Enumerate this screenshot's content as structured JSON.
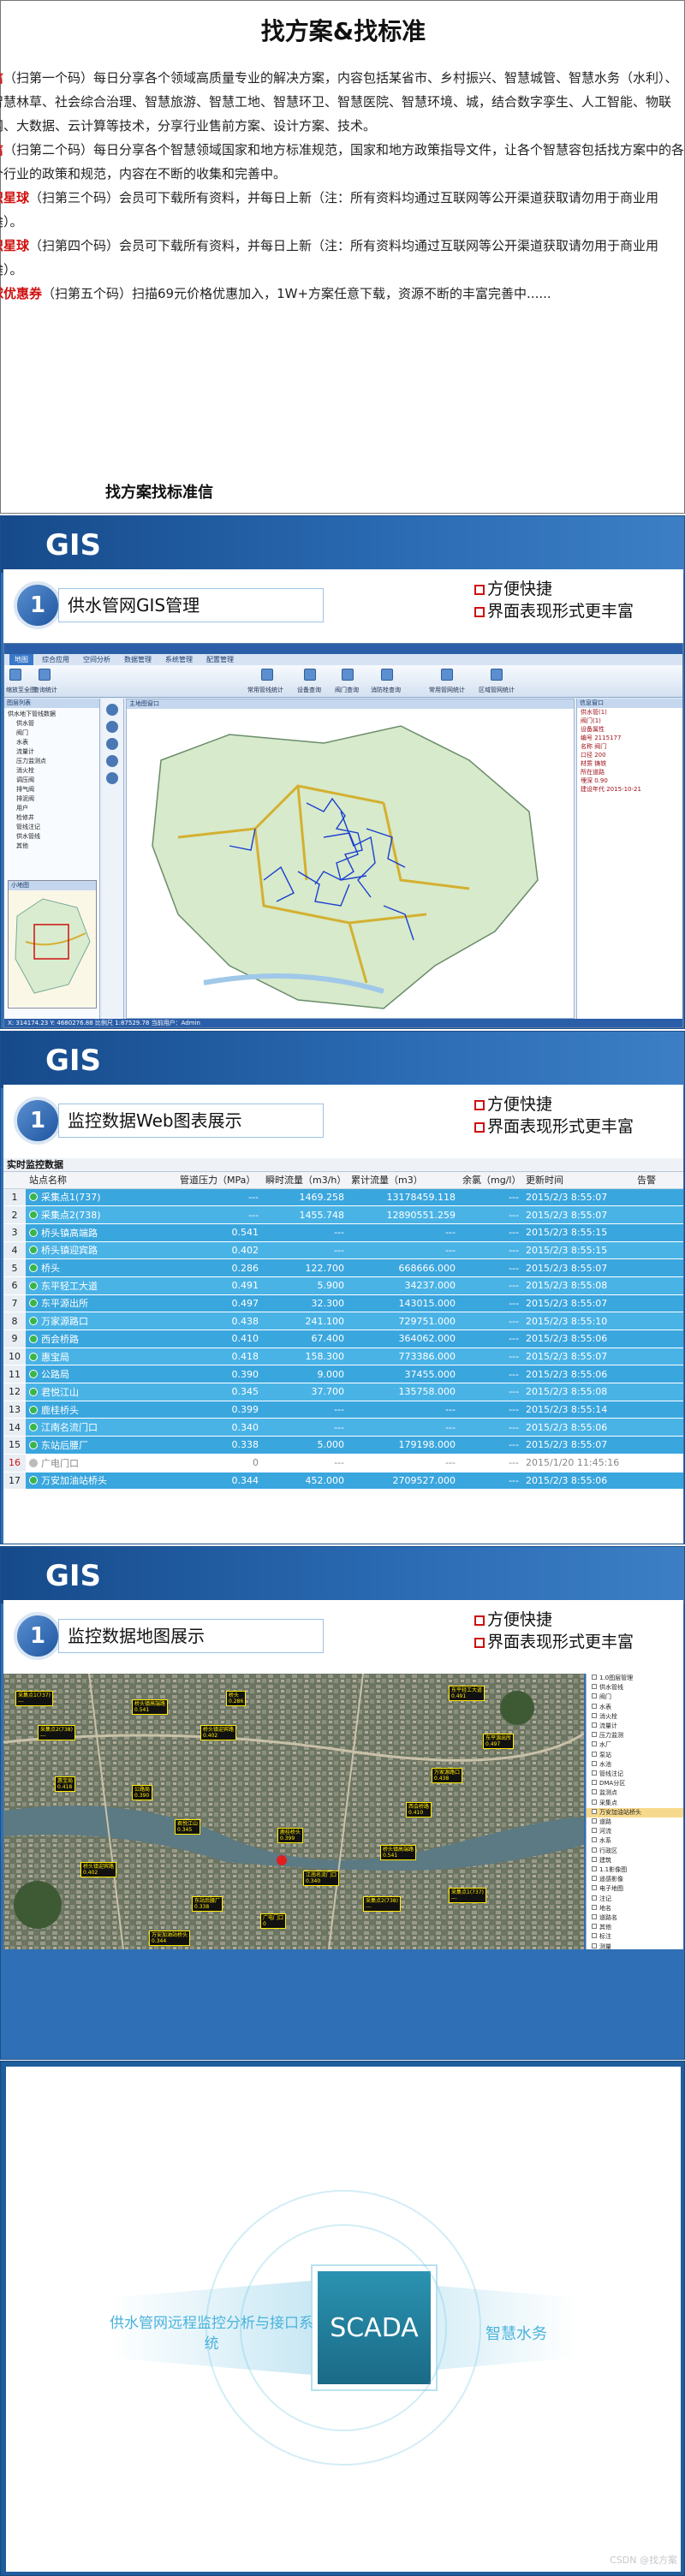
{
  "intro": {
    "title": "找方案&找标准",
    "paragraphs": [
      {
        "tag": "信",
        "text": "（扫第一个码）每日分享各个领域高质量专业的解决方案，内容包括某省市、乡村振兴、智慧城管、智慧水务（水利）、智慧林草、社会综合治理、智慧旅游、智慧工地、智慧环卫、智慧医院、智慧环境、城，结合数字孪生、人工智能、物联网、大数据、云计算等技术，分享行业售前方案、设计方案、技术。"
      },
      {
        "tag": "信",
        "text": "（扫第二个码）每日分享各个智慧领域国家和地方标准规范，国家和地方政策指导文件，让各个智慧容包括找方案中的各个行业的政策和规范，内容在不断的收集和完善中。"
      },
      {
        "tag": "识星球",
        "text": "（扫第三个码）会员可下载所有资料，并每日上新（注：所有资料均通过互联网等公开渠道获取请勿用于商业用途）。"
      },
      {
        "tag": "识星球",
        "text": "（扫第四个码）会员可下载所有资料，并每日上新（注：所有资料均通过互联网等公开渠道获取请勿用于商业用途）。"
      },
      {
        "tag": "球优惠券",
        "text": "（扫第五个码）扫描69元价格优惠加入，1W+方案任意下载，资源不断的丰富完善中......"
      }
    ],
    "footer_label": "找方案找标准信"
  },
  "slide1": {
    "section": "GIS",
    "number": "1",
    "title": "供水管网GIS管理",
    "bullets": [
      "方便快捷",
      "界面表现形式更丰富"
    ],
    "app": {
      "tabs": [
        "地图",
        "综合应用",
        "空间分析",
        "数据管理",
        "系统管理",
        "配置管理"
      ],
      "ribbon_labels": [
        "缩放至全图",
        "查询统计",
        "常用管线统计",
        "设备查询",
        "阀门查询",
        "消防栓查询",
        "常用管网统计",
        "区域管网统计"
      ],
      "left_header": "图层列表",
      "tree": [
        "供水地下管线数据",
        "供水管",
        "阀门",
        "水表",
        "流量计",
        "压力监测点",
        "消火栓",
        "调压阀",
        "排气阀",
        "排泥阀",
        "用户",
        "检修井",
        "管线注记",
        "供水管线",
        "其他"
      ],
      "mini_header": "小地图",
      "map_tab": "主地图窗口",
      "right_header": "信息窗口",
      "right_rows": [
        "供水管(1)",
        "阀门(1)",
        "设备属性",
        "编号 2115177",
        "名称 阀门",
        "口径 200",
        "材质 铸铁",
        "所在道路",
        "埋深 0.90",
        "建设年代 2015-10-21"
      ],
      "status": "X: 314174.23  Y: 4680276.88  比例尺 1:87529.78  当前用户：Admin"
    }
  },
  "slide2": {
    "section": "GIS",
    "number": "1",
    "title": "监控数据Web图表展示",
    "bullets": [
      "方便快捷",
      "界面表现形式更丰富"
    ],
    "caption": "实时监控数据",
    "columns": [
      "站点名称",
      "管道压力（MPa）",
      "瞬时流量（m3/h）",
      "累计流量（m3）",
      "余氯（mg/l）",
      "更新时间",
      "告警"
    ],
    "rows": [
      {
        "no": "1",
        "name": "采集点1(737)",
        "p": "---",
        "q": "1469.258",
        "sum": "13178459.118",
        "cl": "---",
        "time": "2015/2/3 8:55:07",
        "ok": true
      },
      {
        "no": "2",
        "name": "采集点2(738)",
        "p": "---",
        "q": "1455.748",
        "sum": "12890551.259",
        "cl": "---",
        "time": "2015/2/3 8:55:07",
        "ok": true
      },
      {
        "no": "3",
        "name": "桥头镇高端路",
        "p": "0.541",
        "q": "---",
        "sum": "---",
        "cl": "---",
        "time": "2015/2/3 8:55:15",
        "ok": true
      },
      {
        "no": "4",
        "name": "桥头镇迎宾路",
        "p": "0.402",
        "q": "---",
        "sum": "---",
        "cl": "---",
        "time": "2015/2/3 8:55:15",
        "ok": true
      },
      {
        "no": "5",
        "name": "桥头",
        "p": "0.286",
        "q": "122.700",
        "sum": "668666.000",
        "cl": "---",
        "time": "2015/2/3 8:55:07",
        "ok": true
      },
      {
        "no": "6",
        "name": "东平轻工大道",
        "p": "0.491",
        "q": "5.900",
        "sum": "34237.000",
        "cl": "---",
        "time": "2015/2/3 8:55:08",
        "ok": true
      },
      {
        "no": "7",
        "name": "东平源出所",
        "p": "0.497",
        "q": "32.300",
        "sum": "143015.000",
        "cl": "---",
        "time": "2015/2/3 8:55:07",
        "ok": true
      },
      {
        "no": "8",
        "name": "万家源路口",
        "p": "0.438",
        "q": "241.100",
        "sum": "729751.000",
        "cl": "---",
        "time": "2015/2/3 8:55:10",
        "ok": true
      },
      {
        "no": "9",
        "name": "西会桥路",
        "p": "0.410",
        "q": "67.400",
        "sum": "364062.000",
        "cl": "---",
        "time": "2015/2/3 8:55:06",
        "ok": true
      },
      {
        "no": "10",
        "name": "惠宝局",
        "p": "0.418",
        "q": "158.300",
        "sum": "773386.000",
        "cl": "---",
        "time": "2015/2/3 8:55:07",
        "ok": true
      },
      {
        "no": "11",
        "name": "公路局",
        "p": "0.390",
        "q": "9.000",
        "sum": "37455.000",
        "cl": "---",
        "time": "2015/2/3 8:55:06",
        "ok": true
      },
      {
        "no": "12",
        "name": "君悦江山",
        "p": "0.345",
        "q": "37.700",
        "sum": "135758.000",
        "cl": "---",
        "time": "2015/2/3 8:55:08",
        "ok": true
      },
      {
        "no": "13",
        "name": "鹿桂桥头",
        "p": "0.399",
        "q": "---",
        "sum": "---",
        "cl": "---",
        "time": "2015/2/3 8:55:14",
        "ok": true
      },
      {
        "no": "14",
        "name": "江南名流门口",
        "p": "0.340",
        "q": "---",
        "sum": "---",
        "cl": "---",
        "time": "2015/2/3 8:55:06",
        "ok": true
      },
      {
        "no": "15",
        "name": "东站后腰厂",
        "p": "0.338",
        "q": "5.000",
        "sum": "179198.000",
        "cl": "---",
        "time": "2015/2/3 8:55:07",
        "ok": true
      },
      {
        "no": "16",
        "name": "广电门口",
        "p": "0",
        "q": "---",
        "sum": "---",
        "cl": "---",
        "time": "2015/1/20 11:45:16",
        "ok": false
      },
      {
        "no": "17",
        "name": "万安加油站桥头",
        "p": "0.344",
        "q": "452.000",
        "sum": "2709527.000",
        "cl": "---",
        "time": "2015/2/3 8:55:06",
        "ok": true
      }
    ]
  },
  "slide3": {
    "section": "GIS",
    "number": "1",
    "title": "监控数据地图展示",
    "bullets": [
      "方便快捷",
      "界面表现形式更丰富"
    ],
    "layers": [
      "1.0图层管理",
      "供水管线",
      "阀门",
      "水表",
      "消火栓",
      "流量计",
      "压力监测",
      "水厂",
      "泵站",
      "水池",
      "管线注记",
      "DMA分区",
      "监测点",
      "采集点",
      "万安加油站桥头",
      "道路",
      "河流",
      "水系",
      "行政区",
      "建筑",
      "1.1影像图",
      "遥感影像",
      "电子地图",
      "注记",
      "地名",
      "道路名",
      "其他",
      "标注",
      "测量"
    ]
  },
  "scada": {
    "left_label": "供水管网远程监控分析与接口系统",
    "center_label": "SCADA",
    "right_label": "智慧水务",
    "watermark": "CSDN @找方案"
  },
  "colors": {
    "slide_bg": "#2f6fb5",
    "table_row": "#4ab3e6",
    "accent_red": "#d01010",
    "scada_box": "#1f7d99"
  }
}
